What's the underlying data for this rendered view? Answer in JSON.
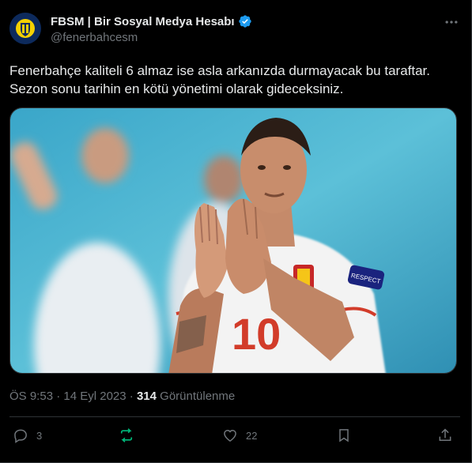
{
  "author": {
    "display_name": "FBSM | Bir Sosyal Medya Hesabı",
    "handle": "@fenerbahcesm"
  },
  "tweet": {
    "lines": [
      "Fenerbahçe kaliteli 6 almaz ise asla arkanızda durmayacak bu taraftar.",
      "Sezon sonu tarihin en kötü yönetimi olarak gideceksiniz."
    ]
  },
  "meta": {
    "time": "ÖS 9:53",
    "date": "14 Eyl 2023",
    "views": "314",
    "views_label": "Görüntülenme"
  },
  "actions": {
    "replies": "3",
    "reposts": "",
    "likes": "22"
  },
  "photo": {
    "jersey_number": "10",
    "badge_text": "RESPECT"
  },
  "colors": {
    "background": "#000000",
    "text": "#e7e9ea",
    "muted": "#71767b",
    "verified": "#1d9bf0",
    "repost_active": "#00ba7c",
    "border": "#2f3336"
  }
}
